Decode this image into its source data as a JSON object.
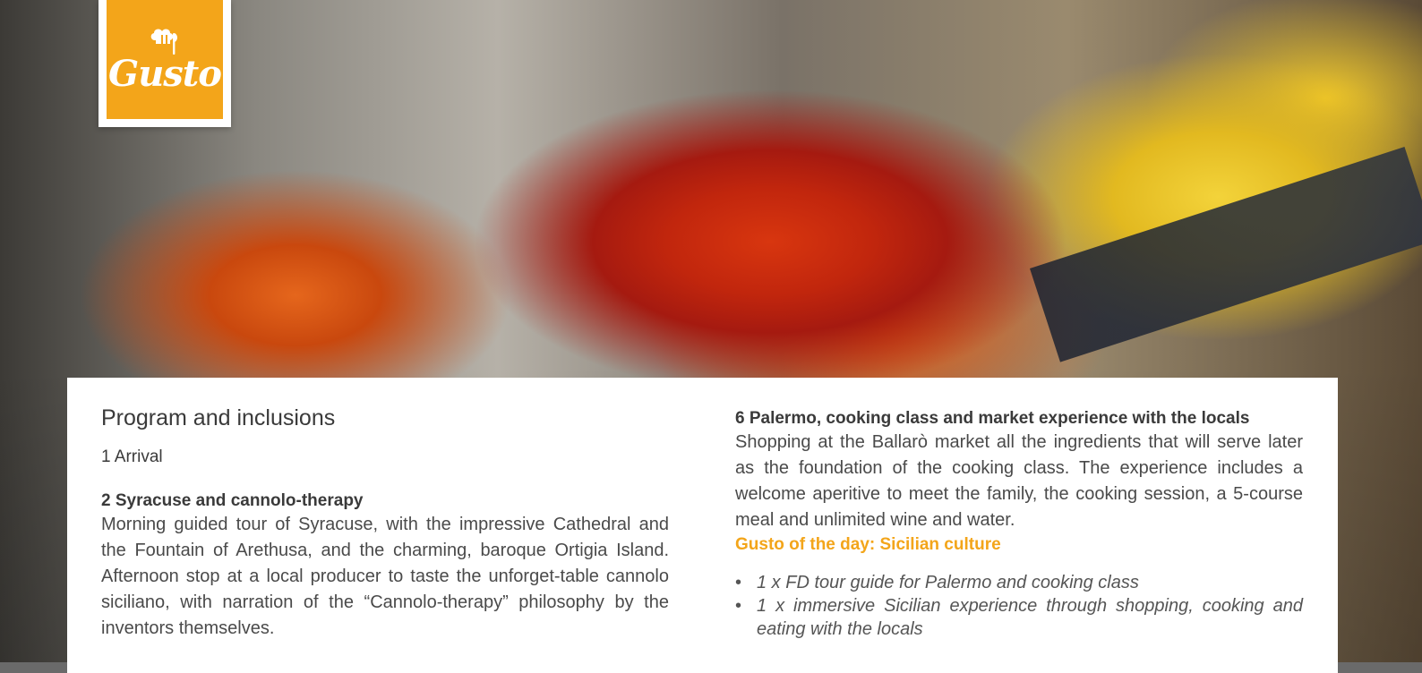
{
  "brand": {
    "logo_text": "Gusto",
    "logo_color": "#f3a51a"
  },
  "program": {
    "title": "Program and inclusions",
    "day1": {
      "title": "1 Arrival"
    },
    "day2": {
      "title": "2 Syracuse and cannolo-therapy",
      "description": "Morning guided tour of Syracuse, with the impressive Cathedral and the Fountain of Arethusa, and the charming, baroque Ortigia Island. Afternoon stop at a local producer to taste the unforget-table cannolo siciliano, with narration of the “Cannolo-therapy” philosophy by the inventors themselves."
    },
    "day6": {
      "title": "6 Palermo, cooking class and market experience with the locals",
      "description": "Shopping at the Ballarò market all the ingredients that will serve later as the foundation of the cooking class. The experience includes a welcome aperitive to meet the family, the cooking session, a 5-course meal and unlimited wine and water.",
      "highlight": "Gusto of the day: Sicilian culture",
      "inclusions": [
        "1 x FD tour guide for Palermo and cooking class",
        "1 x immersive Sicilian experience through shopping, cooking and eating with the locals"
      ]
    }
  }
}
